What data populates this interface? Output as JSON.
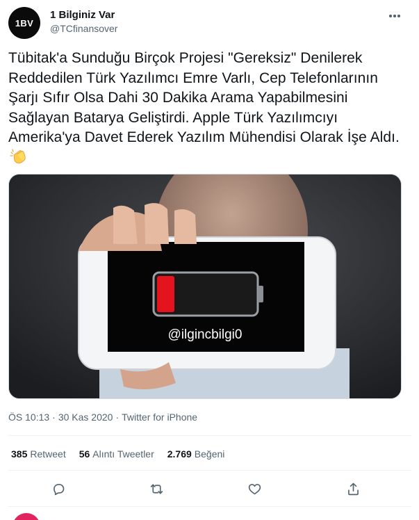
{
  "author": {
    "avatar_text": "1BV",
    "display_name": "1 Bilginiz Var",
    "handle": "@TCfinansover"
  },
  "tweet": {
    "text": "Tübitak'a Sunduğu Birçok Projesi \"Gereksiz\" Denilerek Reddedilen Türk Yazılımcı Emre Varlı, Cep Telefonlarının Şarjı Sıfır Olsa Dahi 30 Dakika Arama Yapabilmesini Sağlayan Batarya Geliştirdi. Apple Türk Yazılımcıyı Amerika'ya Davet Ederek Yazılım Mühendisi Olarak İşe Aldı.",
    "emoji": "clapping-hands",
    "media_watermark": "@ilgincbilgi0",
    "media_battery_level": 0.18
  },
  "meta": {
    "time": "ÖS 10:13",
    "date": "30 Kas 2020",
    "source": "Twitter for iPhone",
    "separator": "·"
  },
  "stats": {
    "retweets": {
      "count": "385",
      "label": "Retweet"
    },
    "quotes": {
      "count": "56",
      "label": "Alıntı Tweetler"
    },
    "likes": {
      "count": "2.769",
      "label": "Beğeni"
    }
  },
  "actions": [
    "reply-icon",
    "retweet-icon",
    "like-icon",
    "share-icon"
  ],
  "colors": {
    "text": "#0f1419",
    "secondary": "#536471",
    "divider": "#eff3f4",
    "battery_red": "#e3141b"
  }
}
